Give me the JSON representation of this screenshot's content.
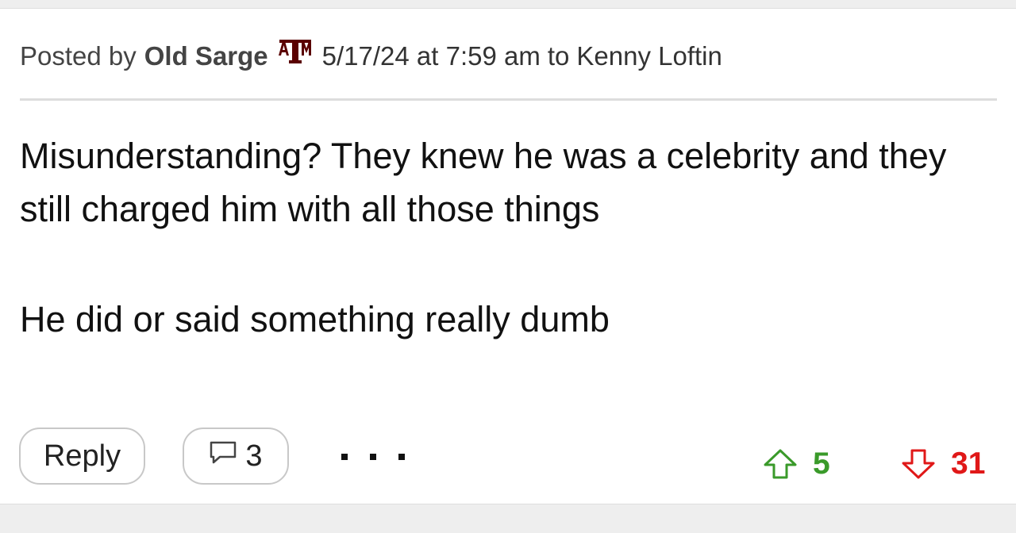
{
  "post": {
    "header": {
      "posted_by": "Posted by",
      "author": "Old Sarge",
      "team_logo_text": "ATM",
      "date": "5/17/24 at 7:59 am",
      "to_label": "to",
      "recipient": "Kenny Loftin"
    },
    "body": {
      "paragraph_1": "Misunderstanding? They knew he was a celebrity and they still charged him with all those things",
      "paragraph_2": "He did or said something really dumb"
    },
    "actions": {
      "reply_label": "Reply",
      "comment_count": "3",
      "upvotes": "5",
      "downvotes": "31"
    }
  },
  "icons": {
    "team_logo": "texas-am-logo-icon",
    "comment": "speech-bubble-icon",
    "more": "ellipsis-icon",
    "upvote": "arrow-up-icon",
    "downvote": "arrow-down-icon"
  },
  "colors": {
    "author_text": "#444444",
    "team_logo": "#5a0000",
    "upvote": "#3a9a2a",
    "downvote": "#e01818",
    "button_border": "#c8c8c8",
    "divider": "#dddddd",
    "page_background": "#eeeeee"
  }
}
